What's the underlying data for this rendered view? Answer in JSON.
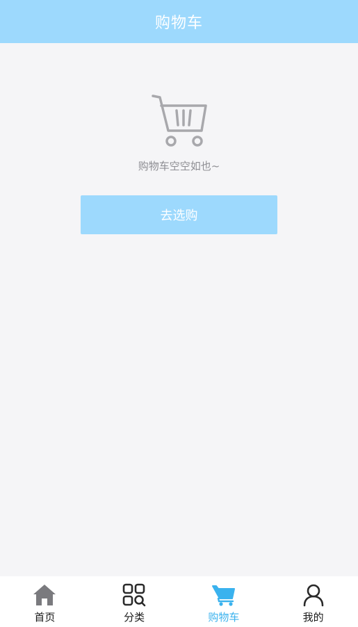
{
  "header": {
    "title": "购物车"
  },
  "empty_state": {
    "icon": "shopping-cart-icon",
    "message": "购物车空空如也~",
    "button_label": "去选购"
  },
  "tabbar": {
    "active_index": 2,
    "items": [
      {
        "label": "首页",
        "icon": "home-icon"
      },
      {
        "label": "分类",
        "icon": "category-search-icon"
      },
      {
        "label": "购物车",
        "icon": "cart-icon"
      },
      {
        "label": "我的",
        "icon": "user-icon"
      }
    ]
  },
  "colors": {
    "primary": "#9dd9fd",
    "active_tab": "#3ab2ee",
    "background": "#f5f5f7",
    "muted_text": "#8e8e93"
  }
}
